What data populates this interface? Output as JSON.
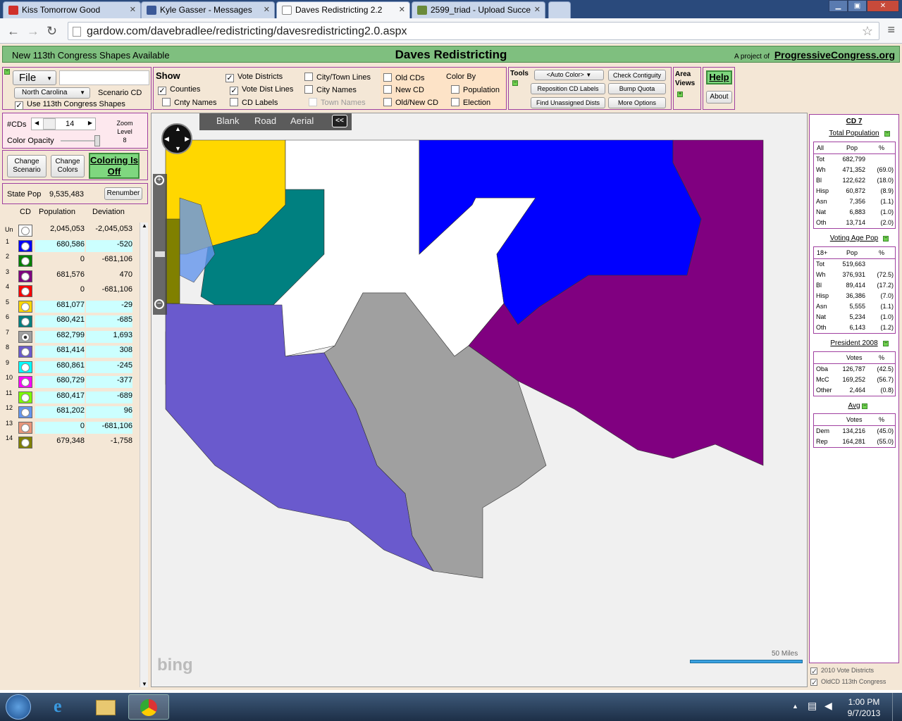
{
  "browser": {
    "tabs": [
      {
        "title": "Kiss Tomorrow Good",
        "icon": "iheart-icon"
      },
      {
        "title": "Kyle Gasser - Messages",
        "icon": "facebook-icon"
      },
      {
        "title": "Daves Redistricting 2.2",
        "icon": "page-icon"
      },
      {
        "title": "2599_triad - Upload Succe",
        "icon": "upload-icon"
      }
    ],
    "url": "gardow.com/davebradlee/redistricting/davesredistricting2.0.aspx"
  },
  "header": {
    "left": "New 113th Congress Shapes Available",
    "title": "Daves Redistricting",
    "project_prefix": "A project of",
    "project_link": "ProgressiveCongress.org"
  },
  "file_panel": {
    "file_label": "File",
    "state": "North Carolina",
    "scenario": "Scenario CD",
    "use113": "Use 113th Congress Shapes"
  },
  "show_panel": {
    "title": "Show",
    "items": {
      "counties": "Counties",
      "cnty_names": "Cnty Names",
      "vote_districts": "Vote Districts",
      "vote_dist_lines": "Vote Dist Lines",
      "cd_labels": "CD Labels",
      "city_town_lines": "City/Town Lines",
      "city_names": "City Names",
      "town_names": "Town Names",
      "old_cds": "Old CDs",
      "new_cd": "New CD",
      "old_new_cd": "Old/New CD",
      "color_by": "Color By",
      "population": "Population",
      "election": "Election"
    }
  },
  "tools": {
    "title": "Tools",
    "auto_color": "<Auto Color>",
    "reposition": "Reposition CD Labels",
    "find_unassigned": "Find Unassigned Dists",
    "check_contiguity": "Check Contiguity",
    "bump_quota": "Bump Quota",
    "more_options": "More Options",
    "area_views": "Area Views",
    "help": "Help",
    "about": "About"
  },
  "left_controls": {
    "cds_label": "#CDs",
    "cds_value": "14",
    "zoom_label": "Zoom Level",
    "zoom_value": "8",
    "opacity_label": "Color Opacity",
    "change_scenario": "Change Scenario",
    "change_colors": "Change Colors",
    "coloring": "Coloring Is Off",
    "state_pop_label": "State Pop",
    "state_pop": "9,535,483",
    "renumber": "Renumber"
  },
  "cd_table": {
    "headers": [
      "CD",
      "Population",
      "Deviation"
    ],
    "rows": [
      {
        "cd": "Un",
        "pop": "2,045,053",
        "dev": "-2,045,053",
        "color": "#ffffff",
        "highlight": false
      },
      {
        "cd": "1",
        "pop": "680,586",
        "dev": "-520",
        "color": "#0000ff",
        "highlight": true
      },
      {
        "cd": "2",
        "pop": "0",
        "dev": "-681,106",
        "color": "#008000",
        "highlight": false
      },
      {
        "cd": "3",
        "pop": "681,576",
        "dev": "470",
        "color": "#800080",
        "highlight": false
      },
      {
        "cd": "4",
        "pop": "0",
        "dev": "-681,106",
        "color": "#ff0000",
        "highlight": false
      },
      {
        "cd": "5",
        "pop": "681,077",
        "dev": "-29",
        "color": "#ffd700",
        "highlight": true
      },
      {
        "cd": "6",
        "pop": "680,421",
        "dev": "-685",
        "color": "#008080",
        "highlight": true
      },
      {
        "cd": "7",
        "pop": "682,799",
        "dev": "1,693",
        "color": "#a0a0a0",
        "highlight": true
      },
      {
        "cd": "8",
        "pop": "681,414",
        "dev": "308",
        "color": "#6a5acd",
        "highlight": true
      },
      {
        "cd": "9",
        "pop": "680,861",
        "dev": "-245",
        "color": "#00ffff",
        "highlight": true
      },
      {
        "cd": "10",
        "pop": "680,729",
        "dev": "-377",
        "color": "#ff00ff",
        "highlight": true
      },
      {
        "cd": "11",
        "pop": "680,417",
        "dev": "-689",
        "color": "#7cfc00",
        "highlight": true
      },
      {
        "cd": "12",
        "pop": "681,202",
        "dev": "96",
        "color": "#6495ed",
        "highlight": true
      },
      {
        "cd": "13",
        "pop": "0",
        "dev": "-681,106",
        "color": "#e9967a",
        "highlight": true
      },
      {
        "cd": "14",
        "pop": "679,348",
        "dev": "-1,758",
        "color": "#808000",
        "highlight": false
      }
    ]
  },
  "map": {
    "tabs": [
      "Blank",
      "Road",
      "Aerial"
    ],
    "collapse": "<<",
    "scale": "50 Miles",
    "logo": "bing"
  },
  "stats": {
    "title": "CD 7",
    "total_pop_title": "Total Population",
    "total_head": [
      "All",
      "Pop",
      "%"
    ],
    "total_rows": [
      [
        "Tot",
        "682,799",
        ""
      ],
      [
        "Wh",
        "471,352",
        "(69.0)"
      ],
      [
        "Bl",
        "122,622",
        "(18.0)"
      ],
      [
        "Hisp",
        "60,872",
        "(8.9)"
      ],
      [
        "Asn",
        "7,356",
        "(1.1)"
      ],
      [
        "Nat",
        "6,883",
        "(1.0)"
      ],
      [
        "Oth",
        "13,714",
        "(2.0)"
      ]
    ],
    "vap_title": "Voting Age Pop",
    "vap_head": [
      "18+",
      "Pop",
      "%"
    ],
    "vap_rows": [
      [
        "Tot",
        "519,663",
        ""
      ],
      [
        "Wh",
        "376,931",
        "(72.5)"
      ],
      [
        "Bl",
        "89,414",
        "(17.2)"
      ],
      [
        "Hisp",
        "36,386",
        "(7.0)"
      ],
      [
        "Asn",
        "5,555",
        "(1.1)"
      ],
      [
        "Nat",
        "5,234",
        "(1.0)"
      ],
      [
        "Oth",
        "6,143",
        "(1.2)"
      ]
    ],
    "pres_title": "President 2008",
    "pres_head": [
      "",
      "Votes",
      "%"
    ],
    "pres_rows": [
      [
        "Oba",
        "126,787",
        "(42.5)"
      ],
      [
        "McC",
        "169,252",
        "(56.7)"
      ],
      [
        "Other",
        "2,464",
        "(0.8)"
      ]
    ],
    "avg_title": "Avg",
    "avg_head": [
      "",
      "Votes",
      "%"
    ],
    "avg_rows": [
      [
        "Dem",
        "134,216",
        "(45.0)"
      ],
      [
        "Rep",
        "164,281",
        "(55.0)"
      ]
    ],
    "footer1": "2010 Vote Districts",
    "footer2": "OldCD 113th Congress"
  },
  "taskbar": {
    "time": "1:00 PM",
    "date": "9/7/2013"
  }
}
